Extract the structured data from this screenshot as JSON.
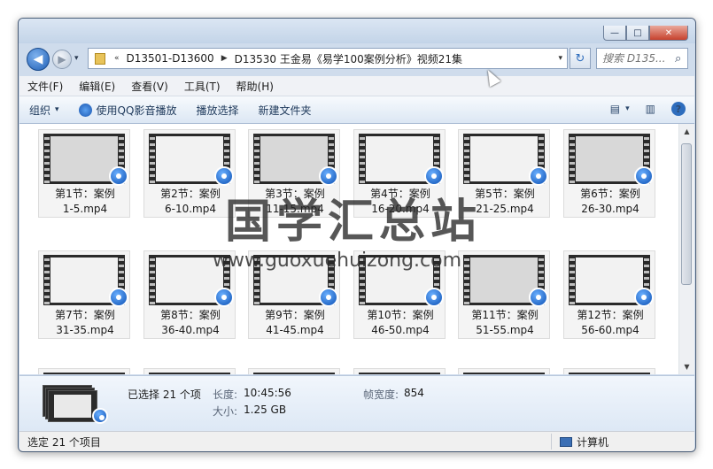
{
  "window": {
    "min_label": "—",
    "max_label": "□",
    "close_label": "✕"
  },
  "nav": {
    "back_icon": "◀",
    "forward_icon": "▶",
    "dropdown_icon": "▾"
  },
  "address": {
    "overflow_icon": "«",
    "separator_icon": "▶",
    "crumbs": [
      "D13501-D13600",
      "D13530 王金易《易学100案例分析》视频21集"
    ],
    "dropdown_icon": "▾"
  },
  "refresh_icon": "↻",
  "search": {
    "placeholder": "搜索 D135...",
    "icon": "⌕"
  },
  "menu": [
    "文件(F)",
    "编辑(E)",
    "查看(V)",
    "工具(T)",
    "帮助(H)"
  ],
  "toolbar": {
    "organize": "组织",
    "organize_arrow": "▾",
    "play_qq": "使用QQ影音播放",
    "play_selection": "播放选择",
    "new_folder": "新建文件夹",
    "view_icon": "▤",
    "view_arrow": "▾",
    "preview_icon": "▥",
    "help_icon": "?"
  },
  "files": [
    {
      "line1": "第1节：案例",
      "line2": "1-5.mp4"
    },
    {
      "line1": "第2节：案例",
      "line2": "6-10.mp4"
    },
    {
      "line1": "第3节：案例",
      "line2": "11-15.mp4"
    },
    {
      "line1": "第4节：案例",
      "line2": "16-20.mp4"
    },
    {
      "line1": "第5节：案例",
      "line2": "21-25.mp4"
    },
    {
      "line1": "第6节：案例",
      "line2": "26-30.mp4"
    },
    {
      "line1": "第7节：案例",
      "line2": "31-35.mp4"
    },
    {
      "line1": "第8节：案例",
      "line2": "36-40.mp4"
    },
    {
      "line1": "第9节：案例",
      "line2": "41-45.mp4"
    },
    {
      "line1": "第10节：案例",
      "line2": "46-50.mp4"
    },
    {
      "line1": "第11节：案例",
      "line2": "51-55.mp4"
    },
    {
      "line1": "第12节：案例",
      "line2": "56-60.mp4"
    }
  ],
  "scroll": {
    "up_icon": "▲",
    "down_icon": "▼"
  },
  "details": {
    "selected": "已选择 21 个项",
    "length_label": "长度:",
    "length_value": "10:45:56",
    "size_label": "大小:",
    "size_value": "1.25 GB",
    "framewidth_label": "帧宽度:",
    "framewidth_value": "854"
  },
  "status": {
    "left": "选定 21 个项目",
    "right": "计算机"
  },
  "watermark": {
    "cn": "国学汇总站",
    "en": "www.guoxuehuizong.com"
  },
  "colors": {
    "accent": "#2e6dbd",
    "window_frame": "#cfdcec",
    "badge": "#0b4fb3"
  }
}
